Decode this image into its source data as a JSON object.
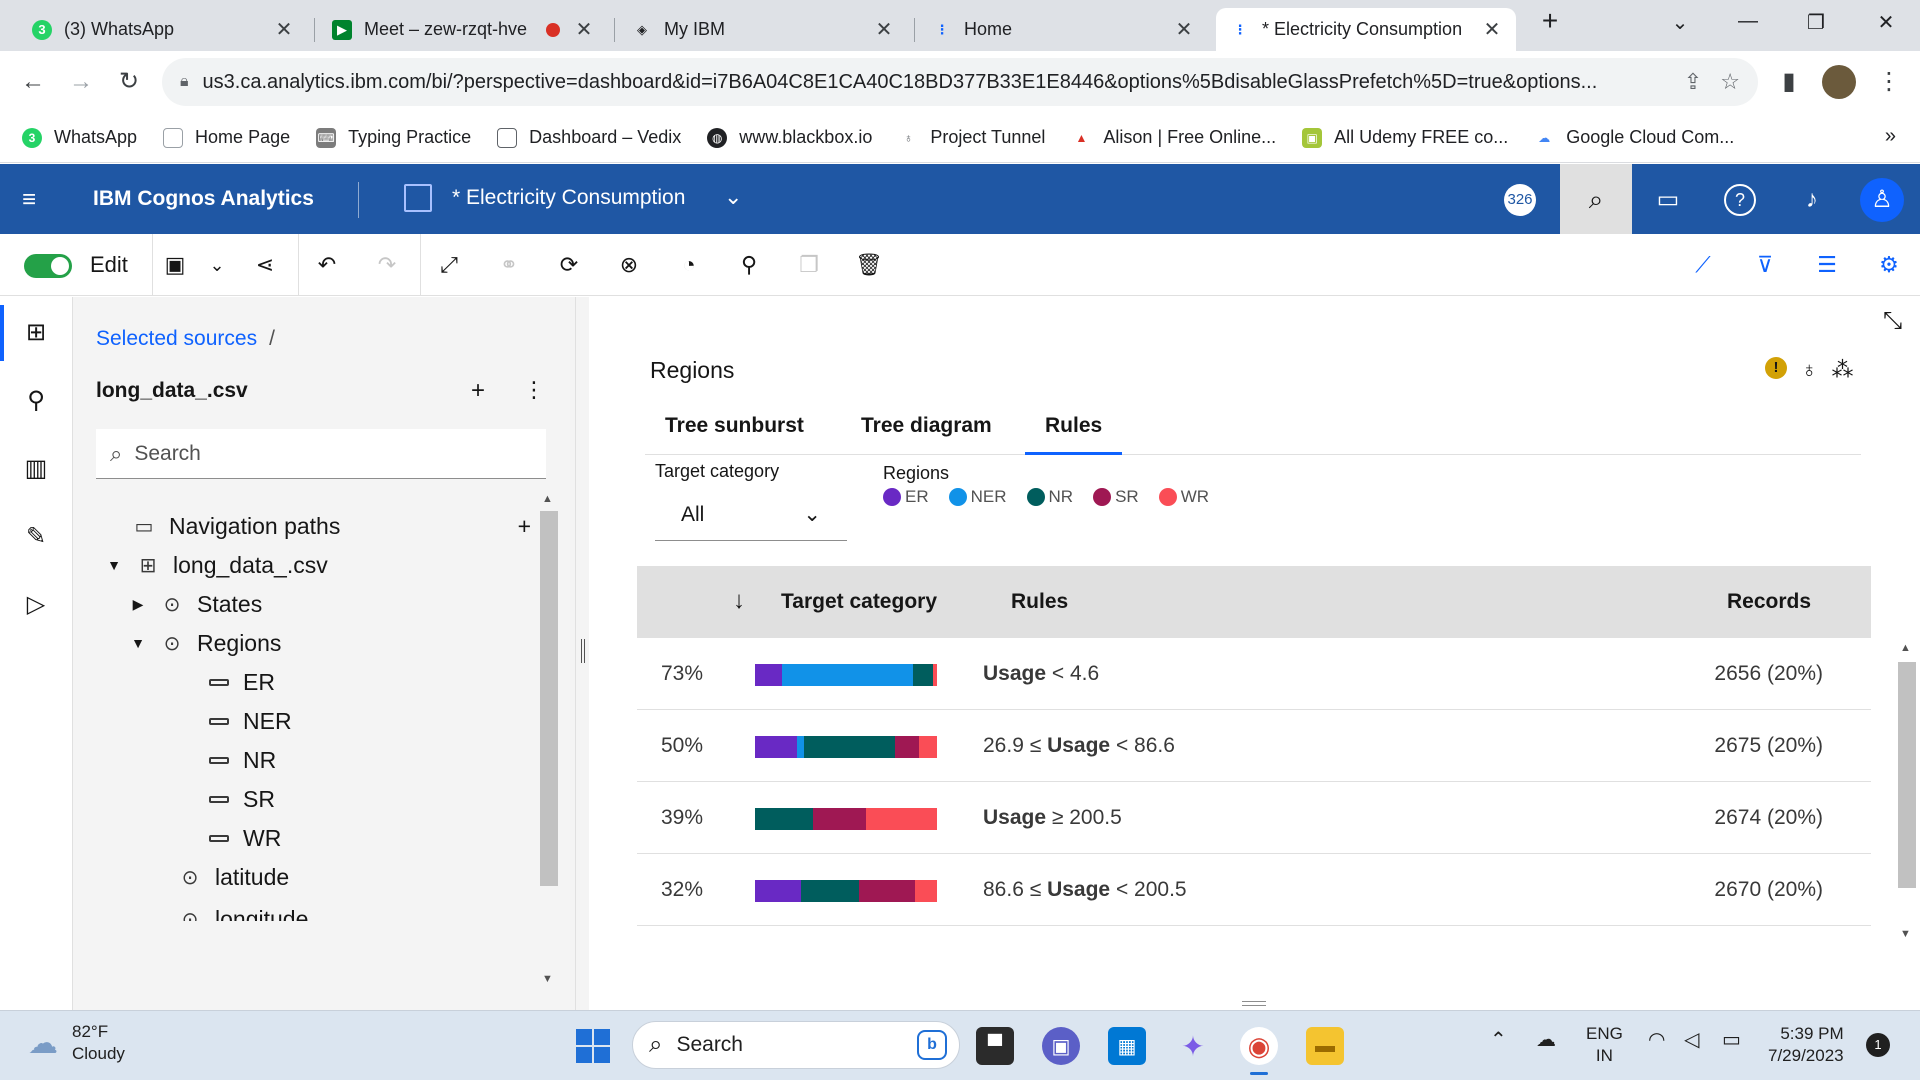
{
  "browser": {
    "tabs": [
      {
        "title": "(3) WhatsApp",
        "icon": "whatsapp-icon"
      },
      {
        "title": "Meet – zew-rzqt-hve",
        "icon": "google-meet-icon"
      },
      {
        "title": "My IBM",
        "icon": "ibm-icon"
      },
      {
        "title": "Home",
        "icon": "cognos-icon"
      },
      {
        "title": "* Electricity Consumption",
        "icon": "cognos-icon"
      }
    ],
    "url": "us3.ca.analytics.ibm.com/bi/?perspective=dashboard&id=i7B6A04C8E1CA40C18BD377B33E1E8446&options%5BdisableGlassPrefetch%5D=true&options...",
    "bookmarks": [
      "WhatsApp",
      "Home Page",
      "Typing Practice",
      "Dashboard – Vedix",
      "www.blackbox.io",
      "Project Tunnel",
      "Alison | Free Online...",
      "All Udemy FREE co...",
      "Google Cloud Com..."
    ]
  },
  "app": {
    "brand": "IBM Cognos Analytics",
    "dashboard_title": "* Electricity Consumption",
    "badge": "326",
    "edit_label": "Edit"
  },
  "panel": {
    "breadcrumb": "Selected sources",
    "breadcrumb_sep": "/",
    "source_name": "long_data_.csv",
    "search_placeholder": "Search",
    "tree": {
      "nav_paths": "Navigation paths",
      "table": "long_data_.csv",
      "states": "States",
      "regions": "Regions",
      "region_items": [
        "ER",
        "NER",
        "NR",
        "SR",
        "WR"
      ],
      "latitude": "latitude",
      "longitude": "longitude"
    }
  },
  "widget": {
    "title": "Regions",
    "tabs": [
      "Tree sunburst",
      "Tree diagram",
      "Rules"
    ],
    "selected_tab": "Rules",
    "target_label": "Target category",
    "target_value": "All",
    "legend_title": "Regions",
    "legend": [
      {
        "name": "ER",
        "color": "#6929c4"
      },
      {
        "name": "NER",
        "color": "#1192e8"
      },
      {
        "name": "NR",
        "color": "#005d5d"
      },
      {
        "name": "SR",
        "color": "#9f1853"
      },
      {
        "name": "WR",
        "color": "#fa4d56"
      }
    ],
    "table": {
      "headers": {
        "target": "Target category",
        "rules": "Rules",
        "records": "Records"
      },
      "rows": [
        {
          "pct": "73%",
          "rule_pre": "",
          "rule_var": "Usage",
          "rule_post": " < 4.6",
          "records": "2656 (20%)",
          "mix": [
            0.15,
            0.72,
            0.11,
            0,
            0.02
          ]
        },
        {
          "pct": "50%",
          "rule_pre": "26.9 ≤ ",
          "rule_var": "Usage",
          "rule_post": " < 86.6",
          "records": "2675 (20%)",
          "mix": [
            0.23,
            0.04,
            0.5,
            0.13,
            0.1
          ]
        },
        {
          "pct": "39%",
          "rule_pre": "",
          "rule_var": "Usage",
          "rule_post": " ≥ 200.5",
          "records": "2674 (20%)",
          "mix": [
            0,
            0,
            0.32,
            0.29,
            0.39
          ]
        },
        {
          "pct": "32%",
          "rule_pre": "86.6 ≤ ",
          "rule_var": "Usage",
          "rule_post": " < 200.5",
          "records": "2670 (20%)",
          "mix": [
            0.25,
            0,
            0.32,
            0.31,
            0.12
          ]
        }
      ]
    }
  },
  "taskbar": {
    "temp": "82°F",
    "condition": "Cloudy",
    "search": "Search",
    "lang1": "ENG",
    "lang2": "IN",
    "time": "5:39 PM",
    "date": "7/29/2023",
    "notifications": "1"
  }
}
